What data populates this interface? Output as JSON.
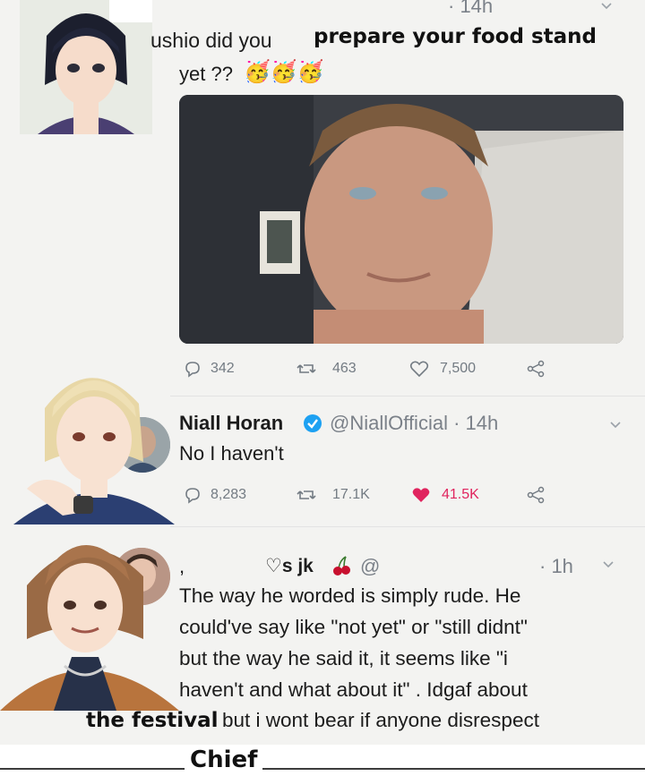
{
  "tweet1": {
    "time": "· 14h",
    "text_line1_prefix": "ushio did you",
    "text_line1_overlay": "prepare your food stand",
    "text_line2": "yet ??",
    "emoji": "🥳🥳🥳",
    "stats": {
      "replies": "342",
      "retweets": "463",
      "likes": "7,500"
    }
  },
  "tweet2": {
    "name": "Niall Horan",
    "handle": "@NiallOfficial · 14h",
    "text": "No I haven't",
    "stats": {
      "replies": "8,283",
      "retweets": "17.1K",
      "likes": "41.5K"
    }
  },
  "tweet3": {
    "name_fragment": "♡s jk",
    "handle_fragment": "@",
    "time": "· 1h",
    "lines": [
      "The way he worded is simply rude. He",
      "could've say like \"not yet\" or \"still didnt\"",
      "but the way he said it, it seems like \"i",
      "haven't and what about it\" . Idgaf about",
      "but i wont bear if anyone disrespect"
    ],
    "overlay_prefix": "the festival"
  },
  "footer_overlay": "Chief",
  "icons": [
    "reply-icon",
    "retweet-icon",
    "heart-icon",
    "share-icon",
    "verified-icon",
    "chevron-down-icon",
    "cherry-icon"
  ],
  "colors": {
    "verified": "#1da1f2",
    "liked_heart": "#e0245e",
    "gray": "#7b8189"
  }
}
